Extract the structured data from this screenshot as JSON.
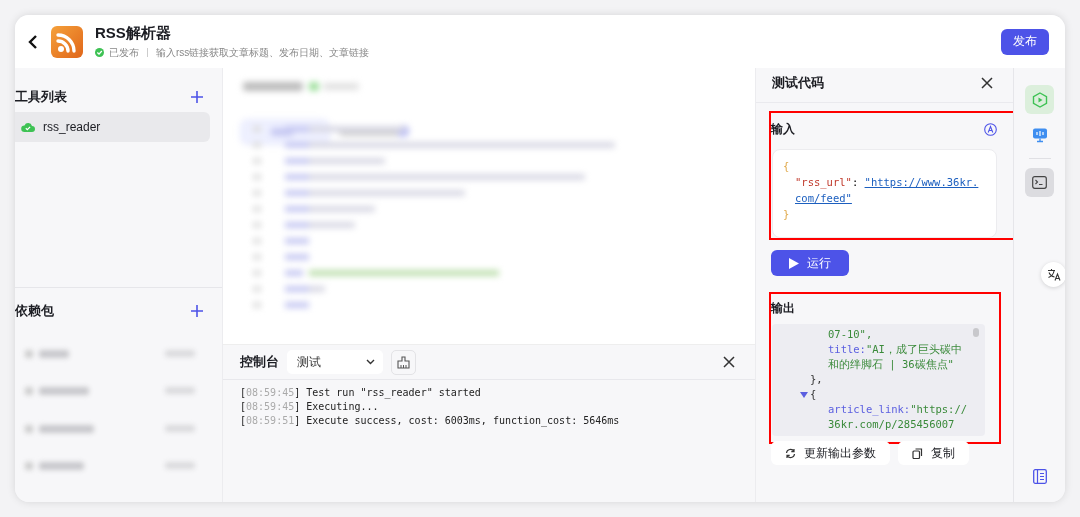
{
  "header": {
    "title": "RSS解析器",
    "status": "已发布",
    "published": true,
    "description": "输入rss链接获取文章标题、发布日期、文章链接",
    "publish_button": "发布"
  },
  "sidebar": {
    "tools_title": "工具列表",
    "tools": [
      {
        "name": "rss_reader",
        "selected": true,
        "deployed": true
      }
    ],
    "deps_title": "依赖包"
  },
  "console": {
    "title": "控制台",
    "mode": "测试",
    "logs": [
      {
        "open": "[",
        "time": "08:59:45",
        "close": "]",
        "message": "Test run \"rss_reader\" started"
      },
      {
        "open": "[",
        "time": "08:59:45",
        "close": "]",
        "message": "Executing..."
      },
      {
        "open": "[",
        "time": "08:59:51",
        "close": "]",
        "message": "Execute success, cost: 6003ms, function_cost: 5646ms"
      }
    ]
  },
  "test_panel": {
    "title": "测试代码",
    "input_label": "输入",
    "input": {
      "open": "{",
      "key": "\"rss_url\"",
      "colon": ": ",
      "value": "\"https://www.36kr.com/feed\"",
      "close": "}"
    },
    "run_button": "运行",
    "output_label": "输出",
    "output": [
      {
        "kind": "tail",
        "value": "07-10\","
      },
      {
        "kind": "pair",
        "key": "title:",
        "value": "\"AI，成了巨头碳中和的绊脚石 | 36碳焦点\""
      },
      {
        "kind": "close",
        "text": "},"
      },
      {
        "kind": "open",
        "text": "{",
        "expanded": true
      },
      {
        "kind": "pair",
        "key": "article_link:",
        "value": "\"https://36kr.com/p/285456007"
      }
    ],
    "update_button": "更新输出参数",
    "copy_button": "复制"
  }
}
